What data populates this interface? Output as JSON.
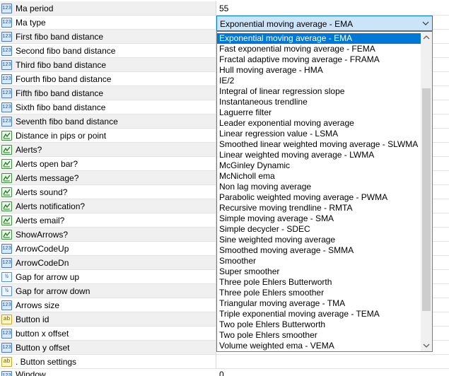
{
  "properties": [
    {
      "icon": "num",
      "label": "Ma period",
      "value": "55"
    },
    {
      "icon": "num",
      "label": "Ma type",
      "value": ""
    },
    {
      "icon": "num",
      "label": "First fibo band distance",
      "value": ""
    },
    {
      "icon": "num",
      "label": "Second fibo band distance",
      "value": ""
    },
    {
      "icon": "num",
      "label": "Third fibo band distance",
      "value": ""
    },
    {
      "icon": "num",
      "label": "Fourth fibo band distance",
      "value": ""
    },
    {
      "icon": "num",
      "label": "Fifth fibo band distance",
      "value": ""
    },
    {
      "icon": "num",
      "label": "Sixth fibo band distance",
      "value": ""
    },
    {
      "icon": "num",
      "label": "Seventh fibo band distance",
      "value": ""
    },
    {
      "icon": "bool",
      "label": "Distance in pips or point",
      "value": ""
    },
    {
      "icon": "bool",
      "label": "Alerts?",
      "value": ""
    },
    {
      "icon": "bool",
      "label": "Alerts open bar?",
      "value": ""
    },
    {
      "icon": "bool",
      "label": "Alerts message?",
      "value": ""
    },
    {
      "icon": "bool",
      "label": "Alerts sound?",
      "value": ""
    },
    {
      "icon": "bool",
      "label": "Alerts notification?",
      "value": ""
    },
    {
      "icon": "bool",
      "label": "Alerts email?",
      "value": ""
    },
    {
      "icon": "bool",
      "label": "ShowArrows?",
      "value": ""
    },
    {
      "icon": "num",
      "label": "ArrowCodeUp",
      "value": ""
    },
    {
      "icon": "num",
      "label": "ArrowCodeDn",
      "value": ""
    },
    {
      "icon": "frac",
      "label": "Gap for arrow up",
      "value": ""
    },
    {
      "icon": "frac",
      "label": "Gap for arrow down",
      "value": ""
    },
    {
      "icon": "num",
      "label": "Arrows size",
      "value": ""
    },
    {
      "icon": "str",
      "label": "Button id",
      "value": ""
    },
    {
      "icon": "num",
      "label": "button x offset",
      "value": ""
    },
    {
      "icon": "num",
      "label": "Button y offset",
      "value": ""
    },
    {
      "icon": "str",
      "label": ".          Button settings",
      "value": ""
    }
  ],
  "cut_row": {
    "label": "Window",
    "value": "0"
  },
  "combo": {
    "selected": "Exponential moving average - EMA"
  },
  "dropdown_options": [
    "Exponential moving average - EMA",
    "Fast exponential moving average - FEMA",
    "Fractal adaptive moving average - FRAMA",
    "Hull moving average - HMA",
    "IE/2",
    "Integral of linear regression slope",
    "Instantaneous trendline",
    "Laguerre filter",
    "Leader exponential moving average",
    "Linear regression value - LSMA",
    "Smoothed linear weighted moving average - SLWMA",
    "Linear weighted moving average - LWMA",
    "McGinley Dynamic",
    "McNicholl ema",
    "Non lag moving average",
    "Parabolic weighted moving average - PWMA",
    "Recursive moving trendline - RMTA",
    "Simple moving average - SMA",
    "Simple decycler - SDEC",
    "Sine weighted moving average",
    "Smoothed moving average - SMMA",
    "Smoother",
    "Super smoother",
    "Three pole Ehlers Butterworth",
    "Three pole Ehlers smoother",
    "Triangular moving average - TMA",
    "Triple exponential moving average - TEMA",
    "Two pole Ehlers Butterworth",
    "Two pole Ehlers smoother",
    "Volume weighted ema - VEMA"
  ],
  "icons": {
    "num": "123",
    "frac": "½",
    "str": "ab",
    "bool": "check-chart"
  },
  "colors": {
    "accent": "#0078d7",
    "combo_bg": "#cce4f7",
    "row_shade": "#f0f0f0"
  }
}
